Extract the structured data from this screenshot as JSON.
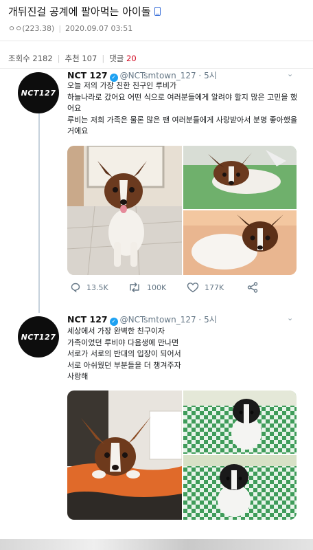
{
  "post": {
    "title": "개뒤진걸 공계에 팔아먹는 아이돌",
    "author": "ㅇㅇ(223.38)",
    "date": "2020.09.07 03:51",
    "views_label": "조회수 2182",
    "recommend_label": "추천 107",
    "comments_label": "댓글",
    "comments_count": "20"
  },
  "tweets": [
    {
      "name": "NCT 127",
      "handle": "@NCTsmtown_127 · 5시",
      "avatar_text": "NCT127",
      "text": "오늘 저의 가장 친한 친구인 루비가\n하늘나라로 갔어요 어떤 식으로 여러분들에게 알려야 할지 많은 고민을 했어요\n루비는 저희 가족은 물론 많은 팬 여러분들에게 사랑받아서 분명 좋아했을거에요",
      "replies": "13.5K",
      "retweets": "100K",
      "likes": "177K"
    },
    {
      "name": "NCT 127",
      "handle": "@NCTsmtown_127 · 5시",
      "avatar_text": "NCT127",
      "text": "세상에서 가장 완벽한 친구이자\n가족이었던 루비야 다음생에 만나면\n서로가 서로의 반대의 입장이 되어서\n서로 아쉬웠던 부분들을 더 챙겨주자\n사랑해"
    }
  ],
  "icons": {
    "reply": "speech-bubble",
    "retweet": "retweet-arrows",
    "like": "heart",
    "share": "share-nodes",
    "verified": "check-badge",
    "menu": "chevron-down"
  },
  "colors": {
    "comment_count": "#d0021b",
    "twitter_blue": "#1da1f2"
  }
}
